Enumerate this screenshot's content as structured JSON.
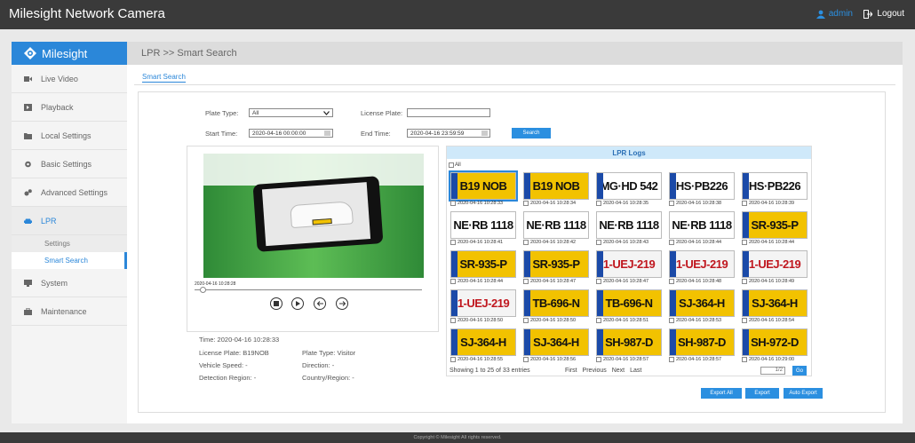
{
  "app_title": "Milesight Network Camera",
  "user": {
    "name": "admin",
    "logout": "Logout"
  },
  "sidebar": {
    "logo": "Milesight",
    "items": [
      {
        "label": "Live Video",
        "icon": "video-icon"
      },
      {
        "label": "Playback",
        "icon": "playback-icon"
      },
      {
        "label": "Local Settings",
        "icon": "folder-icon"
      },
      {
        "label": "Basic Settings",
        "icon": "gear-icon"
      },
      {
        "label": "Advanced Settings",
        "icon": "gears-icon"
      },
      {
        "label": "LPR",
        "icon": "car-icon"
      },
      {
        "label": "System",
        "icon": "monitor-icon"
      },
      {
        "label": "Maintenance",
        "icon": "toolbox-icon"
      }
    ],
    "lpr_sub": [
      "Settings",
      "Smart Search"
    ]
  },
  "breadcrumb": "LPR >> Smart Search",
  "tab": "Smart Search",
  "form": {
    "plate_type_label": "Plate Type:",
    "plate_type_value": "All",
    "license_plate_label": "License Plate:",
    "license_plate_value": "",
    "start_label": "Start Time:",
    "start_value": "2020-04-16 00:00:00",
    "end_label": "End Time:",
    "end_value": "2020-04-16 23:59:59",
    "search": "Search"
  },
  "preview": {
    "timestamp": "2020-04-16 10:28:28",
    "time": "Time: 2020-04-16 10:28:33",
    "license": "License Plate: B19NOB",
    "plate_type": "Plate Type: Visitor",
    "speed": "Vehicle Speed: -",
    "direction": "Direction: -",
    "region": "Detection Region: -",
    "country": "Country/Region: -"
  },
  "logs": {
    "title": "LPR Logs",
    "all": "All",
    "entries": [
      {
        "plate": "B19 NOB",
        "ts": "2020-04-16 10:28:33",
        "bg": "#f2c200",
        "fg": "#111",
        "eu": true
      },
      {
        "plate": "B19 NOB",
        "ts": "2020-04-16 10:28:34",
        "bg": "#f2c200",
        "fg": "#111",
        "eu": true
      },
      {
        "plate": "MG·HD 542",
        "ts": "2020-04-16 10:28:35",
        "bg": "#ffffff",
        "fg": "#111",
        "eu": true
      },
      {
        "plate": "HS·PB226",
        "ts": "2020-04-16 10:28:38",
        "bg": "#ffffff",
        "fg": "#111",
        "eu": true
      },
      {
        "plate": "HS·PB226",
        "ts": "2020-04-16 10:28:39",
        "bg": "#ffffff",
        "fg": "#111",
        "eu": true
      },
      {
        "plate": "NE·RB 1118",
        "ts": "2020-04-16 10:28:41",
        "bg": "#ffffff",
        "fg": "#111",
        "eu": false
      },
      {
        "plate": "NE·RB 1118",
        "ts": "2020-04-16 10:28:42",
        "bg": "#ffffff",
        "fg": "#111",
        "eu": false
      },
      {
        "plate": "NE·RB 1118",
        "ts": "2020-04-16 10:28:43",
        "bg": "#ffffff",
        "fg": "#111",
        "eu": false
      },
      {
        "plate": "NE·RB 1118",
        "ts": "2020-04-16 10:28:44",
        "bg": "#ffffff",
        "fg": "#111",
        "eu": false
      },
      {
        "plate": "SR-935-P",
        "ts": "2020-04-16 10:28:44",
        "bg": "#f2c200",
        "fg": "#111",
        "eu": true
      },
      {
        "plate": "SR-935-P",
        "ts": "2020-04-16 10:28:44",
        "bg": "#f2c200",
        "fg": "#111",
        "eu": true
      },
      {
        "plate": "SR-935-P",
        "ts": "2020-04-16 10:28:47",
        "bg": "#f2c200",
        "fg": "#111",
        "eu": true
      },
      {
        "plate": "1-UEJ-219",
        "ts": "2020-04-16 10:28:47",
        "bg": "#f4f4f4",
        "fg": "#c0171f",
        "eu": true
      },
      {
        "plate": "1-UEJ-219",
        "ts": "2020-04-16 10:28:48",
        "bg": "#f4f4f4",
        "fg": "#c0171f",
        "eu": true
      },
      {
        "plate": "1-UEJ-219",
        "ts": "2020-04-16 10:28:49",
        "bg": "#f4f4f4",
        "fg": "#c0171f",
        "eu": true
      },
      {
        "plate": "1-UEJ-219",
        "ts": "2020-04-16 10:28:50",
        "bg": "#f4f4f4",
        "fg": "#c0171f",
        "eu": true
      },
      {
        "plate": "TB-696-N",
        "ts": "2020-04-16 10:28:50",
        "bg": "#f2c200",
        "fg": "#111",
        "eu": true
      },
      {
        "plate": "TB-696-N",
        "ts": "2020-04-16 10:28:51",
        "bg": "#f2c200",
        "fg": "#111",
        "eu": true
      },
      {
        "plate": "SJ-364-H",
        "ts": "2020-04-16 10:28:53",
        "bg": "#f2c200",
        "fg": "#111",
        "eu": true
      },
      {
        "plate": "SJ-364-H",
        "ts": "2020-04-16 10:28:54",
        "bg": "#f2c200",
        "fg": "#111",
        "eu": true
      },
      {
        "plate": "SJ-364-H",
        "ts": "2020-04-16 10:28:55",
        "bg": "#f2c200",
        "fg": "#111",
        "eu": true
      },
      {
        "plate": "SJ-364-H",
        "ts": "2020-04-16 10:28:56",
        "bg": "#f2c200",
        "fg": "#111",
        "eu": true
      },
      {
        "plate": "SH-987-D",
        "ts": "2020-04-16 10:28:57",
        "bg": "#f2c200",
        "fg": "#111",
        "eu": true
      },
      {
        "plate": "SH-987-D",
        "ts": "2020-04-16 10:28:57",
        "bg": "#f2c200",
        "fg": "#111",
        "eu": true
      },
      {
        "plate": "SH-972-D",
        "ts": "2020-04-16 10:29:00",
        "bg": "#f2c200",
        "fg": "#111",
        "eu": true
      }
    ],
    "showing": "Showing 1 to 25 of 33 entries",
    "pager": "First  Previous  Next  Last",
    "page": "1/2",
    "go": "Go",
    "export_all": "Export All",
    "export": "Export",
    "auto_export": "Auto Export"
  },
  "footer": "Copyright © Milesight All rights reserved.",
  "colors": {
    "accent": "#2b87d9",
    "topbar": "#3a3a3a",
    "plate_yellow": "#f2c200"
  }
}
